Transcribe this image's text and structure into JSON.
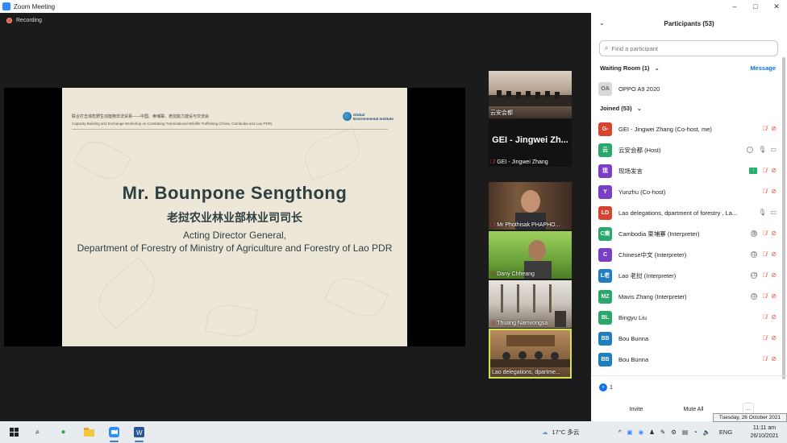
{
  "window": {
    "title": "Zoom Meeting",
    "controls": [
      "–",
      "□",
      "✕"
    ]
  },
  "recording": {
    "label": "Recording"
  },
  "slide": {
    "header_cn": "联合打击濒危野生动植物非法贸易——中国、柬埔寨、老挝能力建设与交流会",
    "header_en": "Capacity Building and Exchange Workshop on Combating Transnational Wildlife Trafficking (China, Cambodia and Lao PDR)",
    "logo_text_1": "Global",
    "logo_text_2": "Environmental Institute",
    "speaker_name": "Mr. Bounpone Sengthong",
    "speaker_title_cn": "老挝农业林业部林业司司长",
    "role_line_1": "Acting Director General,",
    "role_line_2": "Department of Forestry of Ministry of Agriculture and Forestry of Lao PDR"
  },
  "thumbnails": [
    {
      "caption": "云安会都",
      "muted": false,
      "kind": "conference-room"
    },
    {
      "caption": "GEI - Jingwei Zhang",
      "big": "GEI - Jingwei Zh...",
      "muted": true,
      "kind": "text"
    },
    {
      "caption": "Mr Phothisak PHAPHONG",
      "display": "Mr Phothisak PHAPHO...",
      "muted": true,
      "kind": "person"
    },
    {
      "caption": "Dany Chheang",
      "muted": true,
      "kind": "person-green"
    },
    {
      "caption": "Thuang Namvongsa",
      "muted": true,
      "kind": "room"
    },
    {
      "caption": "Lao delegations, dpartme...",
      "muted": false,
      "kind": "delegation"
    }
  ],
  "participants": {
    "header": "Participants (53)",
    "search_placeholder": "Find a participant",
    "waiting_room_label": "Waiting Room (1)",
    "message_label": "Message",
    "waiting": [
      {
        "initials": "OA",
        "name": "OPPO A9 2020",
        "color": "#d9d9d9"
      }
    ],
    "joined_label": "Joined (53)",
    "joined": [
      {
        "initials": "G-",
        "name": "GEI - Jingwei Zhang (Co-host, me)",
        "color": "#d6432f",
        "icons": [
          "mic-off",
          "vid-off"
        ]
      },
      {
        "initials": "云",
        "name": "云安会都 (Host)",
        "color": "#2aa76b",
        "icons": [
          "badge",
          "mic",
          "vid"
        ]
      },
      {
        "initials": "现",
        "name": "现场发言",
        "color": "#7b3fc7",
        "icons": [
          "share",
          "mic-off",
          "vid-off"
        ]
      },
      {
        "initials": "Y",
        "name": "Yunzhu (Co-host)",
        "color": "#7b3fc7",
        "icons": [
          "mic-off",
          "vid-off"
        ]
      },
      {
        "initials": "LD",
        "name": "Lao delegations, dpartment of forestry , La...",
        "color": "#d6432f",
        "icons": [
          "mic",
          "vid"
        ]
      },
      {
        "initials": "C柬",
        "name": "Cambodia 柬埔寨 (Interpreter)",
        "color": "#2aa76b",
        "icons": [
          "badge-cn",
          "mic-off",
          "vid-off"
        ]
      },
      {
        "initials": "C",
        "name": "Chinese中文 (Interpreter)",
        "color": "#7b3fc7",
        "icons": [
          "badge-zh",
          "mic-off",
          "vid-off"
        ]
      },
      {
        "initials": "L老",
        "name": "Lao 老挝 (Interpreter)",
        "color": "#1f7dc2",
        "icons": [
          "badge-lo",
          "mic-off",
          "vid-off"
        ]
      },
      {
        "initials": "MZ",
        "name": "Mavis Zhang (Interpreter)",
        "color": "#2aa76b",
        "icons": [
          "badge-zh",
          "mic-off",
          "vid-off"
        ]
      },
      {
        "initials": "BL",
        "name": "Bingyu Liu",
        "color": "#2aa76b",
        "icons": [
          "mic-off",
          "vid-off"
        ]
      },
      {
        "initials": "BB",
        "name": "Bou Bunna",
        "color": "#1f7dc2",
        "icons": [
          "mic-off",
          "vid-off"
        ]
      },
      {
        "initials": "BB",
        "name": "Bou Bunna",
        "color": "#1f7dc2",
        "icons": [
          "mic-off",
          "vid-off"
        ]
      }
    ],
    "raised_count": "1",
    "invite_label": "Invite",
    "mute_all_label": "Mute All",
    "more_label": "..."
  },
  "tooltip": "Tuesday, 26 October 2021",
  "taskbar": {
    "weather": "17°C 多云",
    "lang": "ENG",
    "time": "11:11 am",
    "date": "26/10/2021"
  }
}
